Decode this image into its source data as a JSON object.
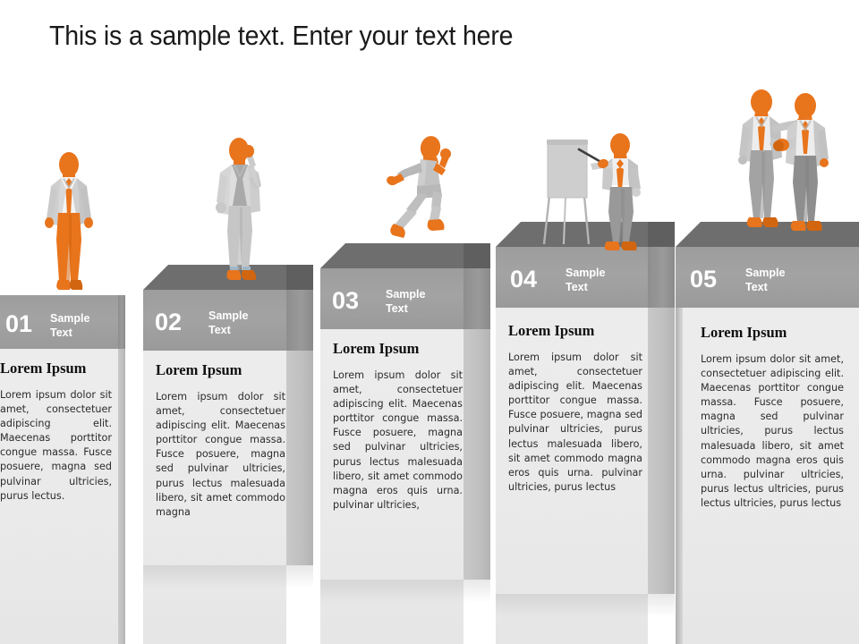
{
  "title": "This is a sample text. Enter your text here",
  "theme": {
    "accent": "#e8741c",
    "accent_dark": "#d2650f",
    "suit_light": "#d2d2d2",
    "suit_mid": "#b9b9b9",
    "suit_dark": "#9a9a9a",
    "shirt": "#f2f2f2",
    "header_gray": "#9f9f9f",
    "top_face_gray": "#6e6e6e",
    "side_gray": "#8e8e8e",
    "panel_gray": "#eaeaea",
    "text_dark": "#1a1a1a",
    "background": "#ffffff"
  },
  "steps": [
    {
      "number": "01",
      "sample_label": "Sample Text",
      "heading": "Lorem Ipsum",
      "body": "Lorem ipsum dolor sit amet, consectetuer adipiscing elit. Maecenas porttitor congue massa. Fusce posuere, magna sed pulvinar ultricies, purus lectus.",
      "figure": "businessman-walking"
    },
    {
      "number": "02",
      "sample_label": "Sample Text",
      "heading": "Lorem Ipsum",
      "body": "Lorem ipsum dolor sit amet, consectetuer adipiscing elit. Maecenas porttitor congue massa. Fusce posuere, magna sed pulvinar ultricies, purus lectus malesuada libero, sit amet commodo magna",
      "figure": "businessman-on-phone"
    },
    {
      "number": "03",
      "sample_label": "Sample Text",
      "heading": "Lorem Ipsum",
      "body": "Lorem ipsum dolor sit amet, consectetuer adipiscing elit. Maecenas porttitor congue massa. Fusce posuere, magna sed pulvinar ultricies, purus lectus malesuada libero, sit amet commodo magna eros quis urna. pulvinar ultricies,",
      "figure": "person-running"
    },
    {
      "number": "04",
      "sample_label": "Sample Text",
      "heading": "Lorem Ipsum",
      "body": "Lorem ipsum dolor sit amet, consectetuer adipiscing elit. Maecenas porttitor congue massa. Fusce posuere, magna sed pulvinar ultricies, purus lectus malesuada libero, sit amet commodo magna eros quis urna. pulvinar ultricies, purus lectus",
      "figure": "presenter-with-flipchart"
    },
    {
      "number": "05",
      "sample_label": "Sample Text",
      "heading": "Lorem Ipsum",
      "body": "Lorem ipsum dolor sit amet, consectetuer adipiscing elit. Maecenas porttitor congue massa. Fusce posuere, magna sed pulvinar ultricies, purus lectus malesuada libero, sit amet commodo magna eros quis urna. pulvinar ultricies, purus lectus ultricies, purus lectus ultricies, purus lectus",
      "figure": "businessmen-handshake"
    }
  ]
}
